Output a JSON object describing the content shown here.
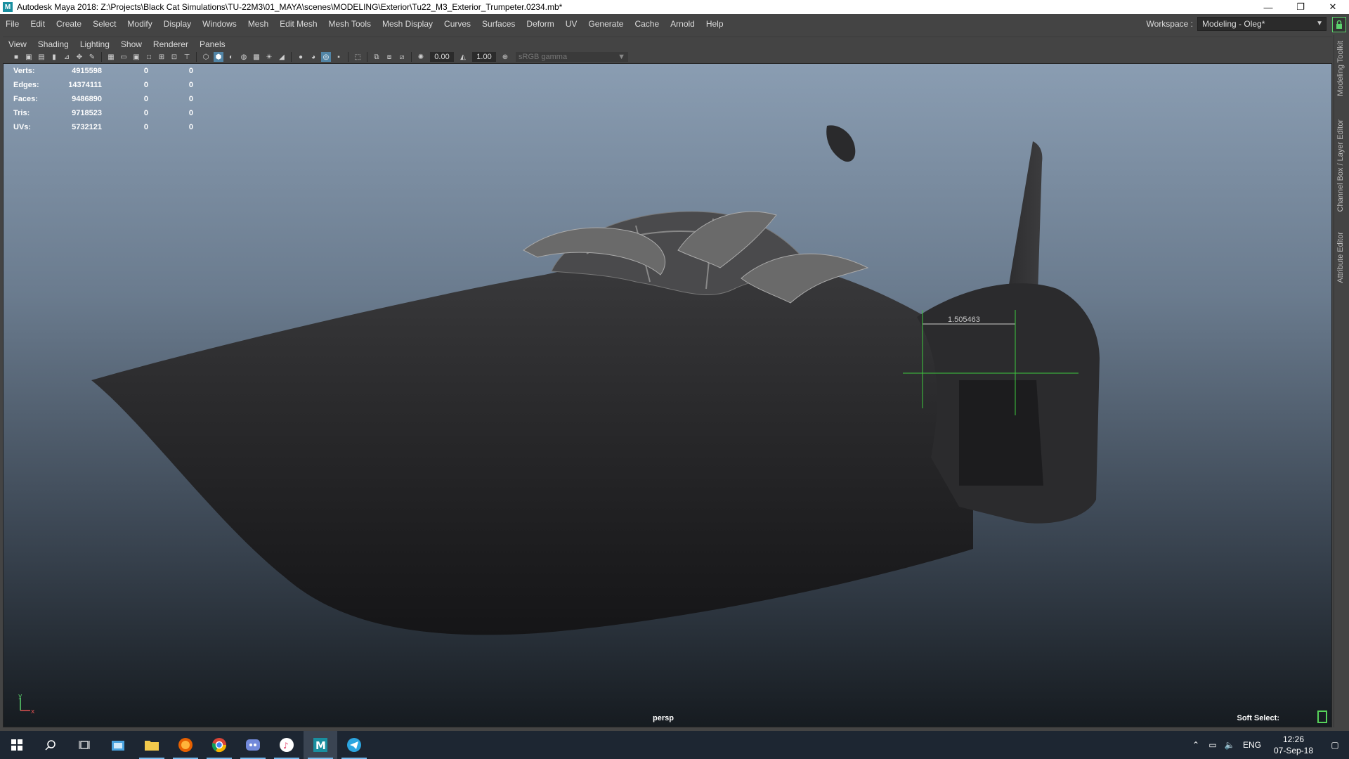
{
  "window": {
    "title": "Autodesk Maya 2018: Z:\\Projects\\Black Cat Simulations\\TU-22M3\\01_MAYA\\scenes\\MODELING\\Exterior\\Tu22_M3_Exterior_Trumpeter.0234.mb*",
    "app_icon_letter": "M",
    "minimize": "—",
    "restore": "❐",
    "close": "✕"
  },
  "menubar": {
    "items": [
      "File",
      "Edit",
      "Create",
      "Select",
      "Modify",
      "Display",
      "Windows",
      "Mesh",
      "Edit Mesh",
      "Mesh Tools",
      "Mesh Display",
      "Curves",
      "Surfaces",
      "Deform",
      "UV",
      "Generate",
      "Cache",
      "Arnold",
      "Help"
    ]
  },
  "workspace": {
    "label": "Workspace :",
    "value": "Modeling - Oleg*"
  },
  "right_dock": {
    "tabs": [
      "Modeling Toolkit",
      "Channel Box / Layer Editor",
      "Attribute Editor"
    ]
  },
  "panel_menu": {
    "items": [
      "View",
      "Shading",
      "Lighting",
      "Show",
      "Renderer",
      "Panels"
    ]
  },
  "viewport_toolbar": {
    "exposure": "0.00",
    "gamma": "1.00",
    "color_space": "sRGB gamma"
  },
  "hud": {
    "rows": [
      {
        "label": "Verts:",
        "value": "4915598",
        "sel": "0",
        "comp": "0"
      },
      {
        "label": "Edges:",
        "value": "14374111",
        "sel": "0",
        "comp": "0"
      },
      {
        "label": "Faces:",
        "value": "9486890",
        "sel": "0",
        "comp": "0"
      },
      {
        "label": "Tris:",
        "value": "9718523",
        "sel": "0",
        "comp": "0"
      },
      {
        "label": "UVs:",
        "value": "5732121",
        "sel": "0",
        "comp": "0"
      }
    ]
  },
  "viewport": {
    "measure_value": "1.505463",
    "camera": "persp",
    "soft_select_label": "Soft Select:",
    "axis_y": "y",
    "axis_x": "x"
  },
  "taskbar": {
    "apps": [
      "start-button",
      "search-icon",
      "task-view-icon",
      "store-icon",
      "file-explorer-icon",
      "firefox-icon",
      "chrome-icon",
      "discord-icon",
      "itunes-icon",
      "maya-icon",
      "telegram-icon"
    ],
    "tray": {
      "language": "ENG",
      "time": "12:26",
      "date": "07-Sep-18"
    }
  }
}
